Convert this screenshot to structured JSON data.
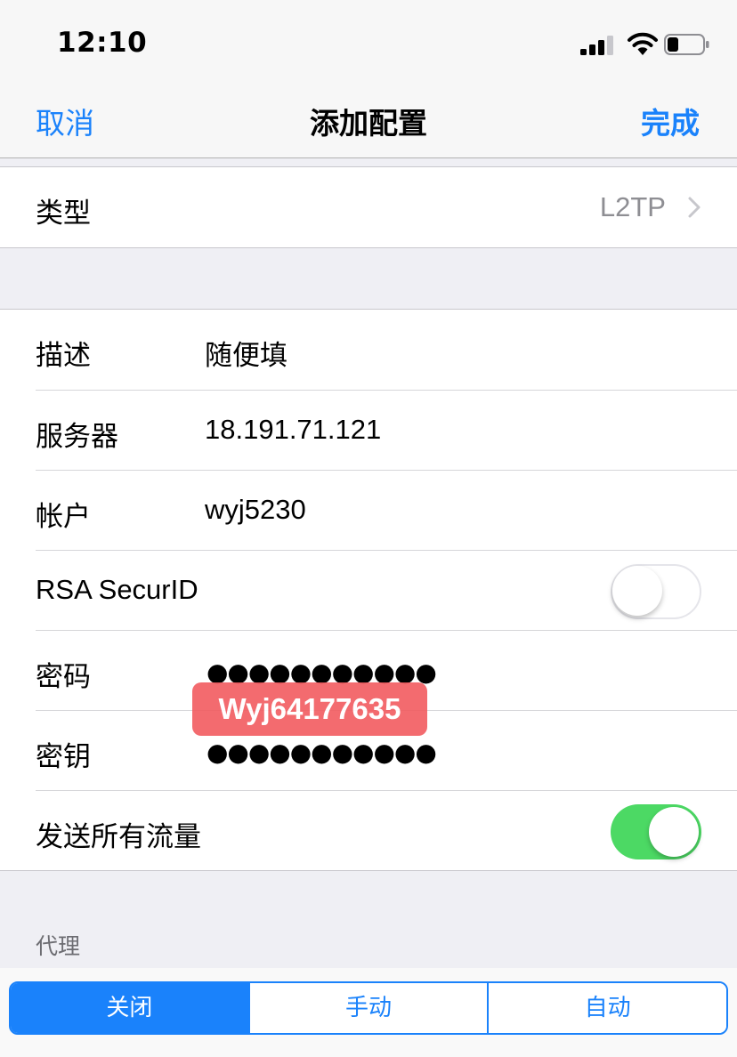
{
  "status_bar": {
    "time": "12:10"
  },
  "nav": {
    "cancel_label": "取消",
    "title": "添加配置",
    "done_label": "完成"
  },
  "type_row": {
    "label": "类型",
    "value": "L2TP"
  },
  "config": {
    "description": {
      "label": "描述",
      "value": "随便填"
    },
    "server": {
      "label": "服务器",
      "value": "18.191.71.121"
    },
    "account": {
      "label": "帐户",
      "value": "wyj5230"
    },
    "rsa": {
      "label": "RSA SecurID",
      "on": false
    },
    "password": {
      "label": "密码",
      "masked": "●●●●●●●●●●●"
    },
    "secret": {
      "label": "密钥",
      "masked": "●●●●●●●●●●●"
    },
    "send_all": {
      "label": "发送所有流量",
      "on": true
    }
  },
  "watermark": {
    "text": "Wyj64177635"
  },
  "proxy": {
    "header": "代理",
    "options": [
      "关闭",
      "手动",
      "自动"
    ],
    "selected": "关闭"
  },
  "colors": {
    "accent": "#1a82fb",
    "toggle_on": "#4cd964",
    "watermark_bg": "#f25b60"
  }
}
